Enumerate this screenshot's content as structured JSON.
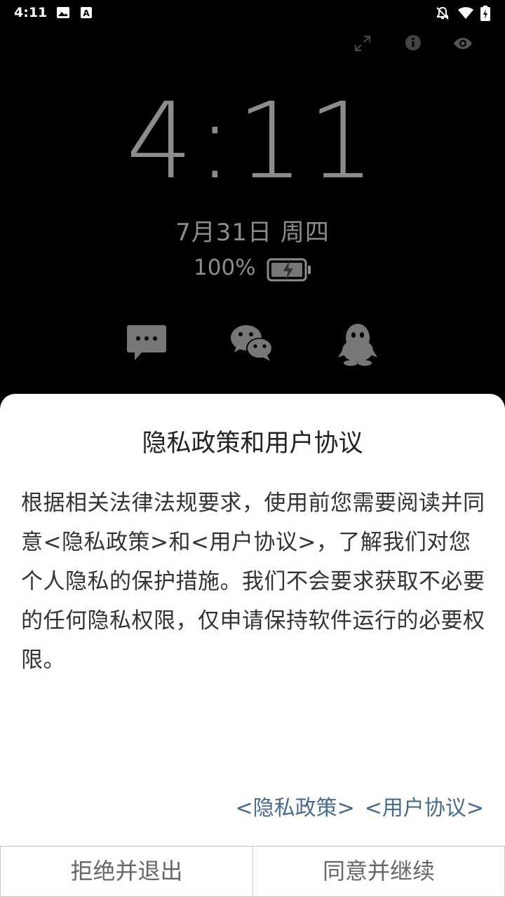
{
  "status_bar": {
    "time": "4:11",
    "icons": [
      "image-icon",
      "font-a-icon",
      "mute-bell-icon",
      "wifi-icon",
      "battery-charging-icon"
    ]
  },
  "top_actions": [
    "expand-icon",
    "info-icon",
    "eye-icon"
  ],
  "lockscreen": {
    "clock": "4:11",
    "date": "7月31日 周四",
    "battery_percent": "100%",
    "apps": [
      "sms-icon",
      "wechat-icon",
      "qq-icon"
    ]
  },
  "dialog": {
    "title": "隐私政策和用户协议",
    "body": "根据相关法律法规要求，使用前您需要阅读并同意<隐私政策>和<用户协议>，了解我们对您个人隐私的保护措施。我们不会要求获取不必要的任何隐私权限，仅申请保持软件运行的必要权限。",
    "link_privacy": "<隐私政策>",
    "link_terms": "<用户协议>",
    "reject_label": "拒绝并退出",
    "accept_label": "同意并继续"
  },
  "colors": {
    "link": "#4a6b8a",
    "lockscreen_text": "#8c8c8c"
  }
}
